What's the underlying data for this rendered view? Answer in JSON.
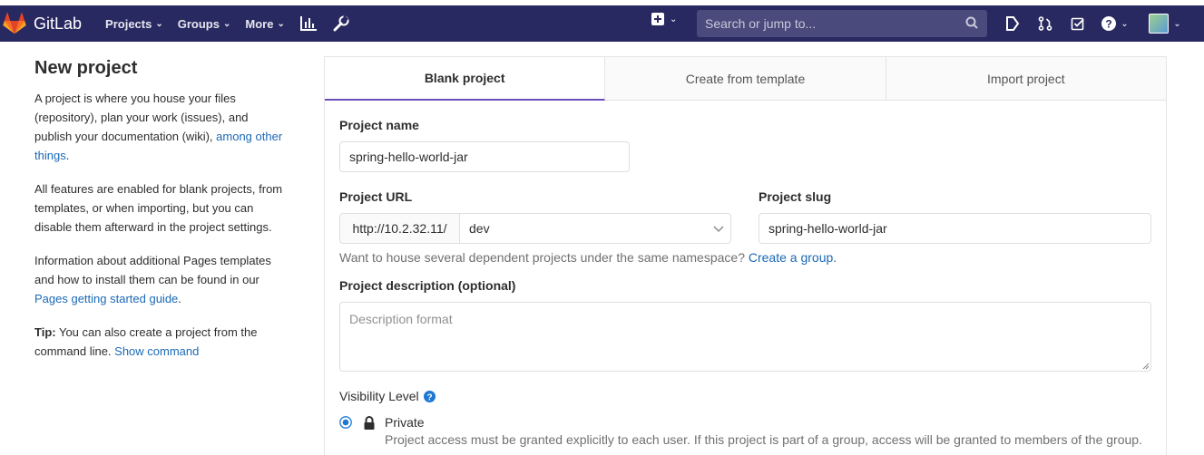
{
  "navbar": {
    "brand": "GitLab",
    "menu": [
      {
        "label": "Projects"
      },
      {
        "label": "Groups"
      },
      {
        "label": "More"
      }
    ],
    "search_placeholder": "Search or jump to...",
    "icons": [
      "chart-bar-icon",
      "wrench-icon",
      "plus-square-icon",
      "todo-icon",
      "merge-request-icon",
      "checklist-icon",
      "help-icon",
      "avatar"
    ]
  },
  "sidebar": {
    "title": "New project",
    "p1_text": "A project is where you house your files (repository), plan your work (issues), and publish your documentation (wiki), ",
    "p1_link": "among other things",
    "p1_end": ".",
    "p2_text": "All features are enabled for blank projects, from templates, or when importing, but you can disable them afterward in the project settings.",
    "p3_text": "Information about additional Pages templates and how to install them can be found in our ",
    "p3_link": "Pages getting started guide",
    "p3_end": ".",
    "tip_label": "Tip:",
    "tip_text": " You can also create a project from the command line. ",
    "tip_link": "Show command"
  },
  "tabs": [
    {
      "label": "Blank project",
      "active": true
    },
    {
      "label": "Create from template",
      "active": false
    },
    {
      "label": "Import project",
      "active": false
    }
  ],
  "form": {
    "project_name_label": "Project name",
    "project_name_value": "spring-hello-world-jar",
    "project_url_label": "Project URL",
    "url_prefix": "http://10.2.32.11/",
    "namespace_value": "dev",
    "project_slug_label": "Project slug",
    "project_slug_value": "spring-hello-world-jar",
    "namespace_help": "Want to house several dependent projects under the same namespace? ",
    "namespace_help_link": "Create a group.",
    "description_label": "Project description (optional)",
    "description_placeholder": "Description format",
    "visibility_label": "Visibility Level",
    "private_label": "Private",
    "private_help": "Project access must be granted explicitly to each user. If this project is part of a group, access will be granted to members of the group."
  },
  "colors": {
    "navbar": "#292961",
    "accent": "#6b4fbb",
    "link": "#1b69b6",
    "radio": "#1f78d1"
  }
}
